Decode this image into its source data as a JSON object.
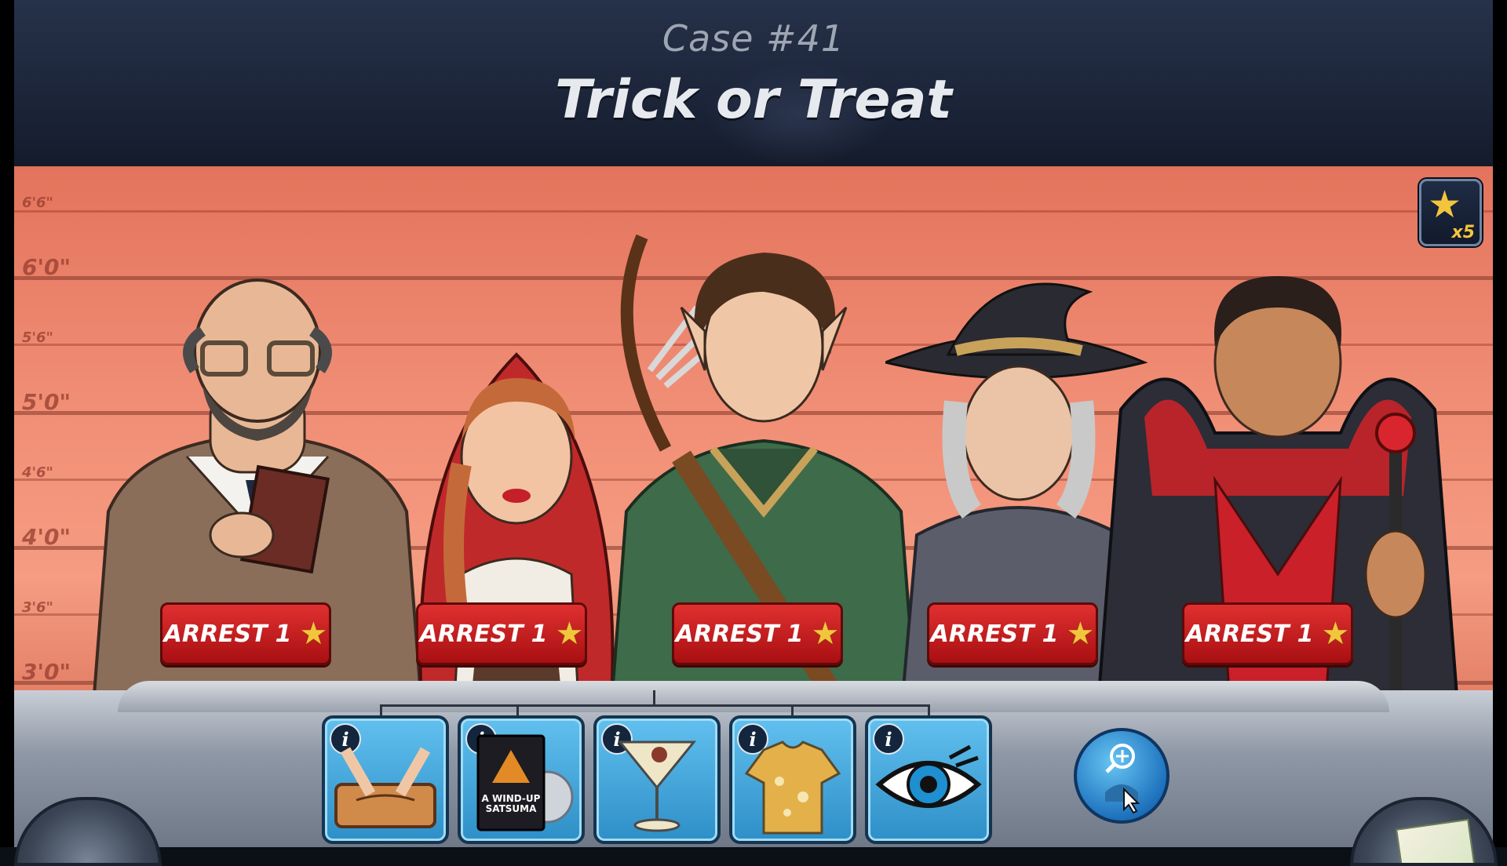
{
  "header": {
    "case_number": "Case #41",
    "case_title": "Trick or Treat"
  },
  "height_chart": {
    "labels": [
      "6'6\"",
      "6'0\"",
      "5'6\"",
      "5'0\"",
      "4'6\"",
      "4'0\"",
      "3'6\"",
      "3'0\""
    ]
  },
  "star_counter": {
    "multiplier": "x5"
  },
  "suspects": [
    {
      "id": "professor",
      "arrest_label": "ARREST",
      "cost": "1"
    },
    {
      "id": "red-riding-hood",
      "arrest_label": "ARREST",
      "cost": "1"
    },
    {
      "id": "archer",
      "arrest_label": "ARREST",
      "cost": "1"
    },
    {
      "id": "witch",
      "arrest_label": "ARREST",
      "cost": "1"
    },
    {
      "id": "vampire",
      "arrest_label": "ARREST",
      "cost": "1"
    }
  ],
  "evidence": [
    {
      "icon": "ouija-board-icon",
      "info": "i"
    },
    {
      "icon": "dvd-case-icon",
      "info": "i",
      "title_text": "A WIND-UP SATSUMA"
    },
    {
      "icon": "martini-glass-icon",
      "info": "i"
    },
    {
      "icon": "shirt-icon",
      "info": "i"
    },
    {
      "icon": "eye-icon",
      "info": "i"
    }
  ],
  "colors": {
    "arrest_button": "#c71c1f",
    "evidence_tile": "#3fa3d8",
    "star": "#f2c53d",
    "lineup_wall": "#f08c74"
  }
}
